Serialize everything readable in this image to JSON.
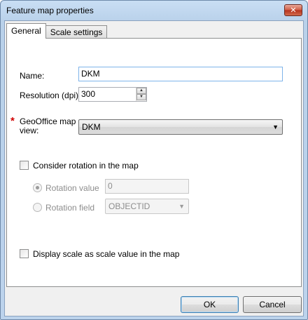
{
  "window": {
    "title": "Feature map properties",
    "close_glyph": "✕"
  },
  "tabs": [
    {
      "label": "General",
      "active": true
    },
    {
      "label": "Scale settings",
      "active": false
    }
  ],
  "general": {
    "name_label": "Name:",
    "name_value": "DKM",
    "resolution_label": "Resolution (dpi):",
    "resolution_value": "300",
    "map_view_label_line1": "GeoOffice map",
    "map_view_label_line2": "view:",
    "map_view_value": "DKM",
    "required_marker": "*",
    "rotation_checkbox_label": "Consider rotation in the map",
    "rotation_value_label": "Rotation value",
    "rotation_value": "0",
    "rotation_field_label": "Rotation field",
    "rotation_field_value": "OBJECTID",
    "scale_checkbox_label": "Display scale as scale value in the map"
  },
  "buttons": {
    "ok": "OK",
    "cancel": "Cancel"
  },
  "colors": {
    "required": "#d00000",
    "focus_border": "#7eb4ea"
  }
}
